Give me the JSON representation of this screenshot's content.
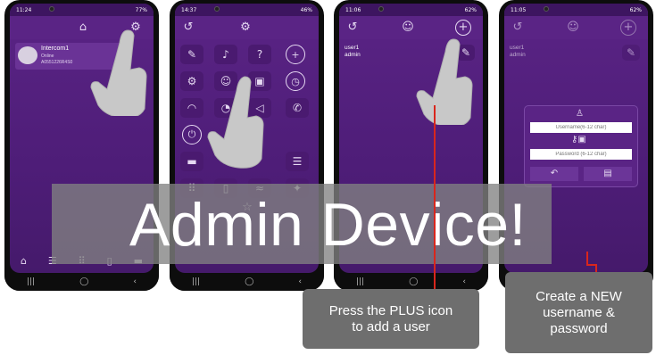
{
  "banner": {
    "title": "Admin Device!"
  },
  "callouts": {
    "plus_hint": "Press the PLUS icon to add a user",
    "create_hint": "Create a NEW username & password"
  },
  "colors": {
    "app_purple": "#5a2485",
    "overlay_gray": "#828282",
    "callout_gray": "#6e6e6e",
    "pointer_line": "#d9261c"
  },
  "phone1": {
    "status_time": "11:24",
    "status_right": "77%",
    "home_icon": "home-icon",
    "settings_icon": "gear-icon",
    "device": {
      "name": "Intercom1",
      "status": "Online",
      "id": "A0551226R4S0"
    },
    "bottom_icons": [
      "home-icon",
      "list-search-icon",
      "keypad-icon",
      "door-icon",
      "chat-icon"
    ]
  },
  "phone2": {
    "status_time": "14:37",
    "status_right": "46%",
    "icons": [
      "back-icon",
      "settings-icon",
      "edit-icon",
      "music-icon",
      "help-icon",
      "plus-icon",
      "settings-multi-icon",
      "users-icon",
      "lock-icon",
      "clock-icon",
      "wifi-icon",
      "bell-icon",
      "volume-icon",
      "phone-icon",
      "power-icon",
      "chat-icon",
      "list-search-icon",
      "keypad-icon",
      "door-open-icon",
      "pool-icon",
      "run-icon",
      "award-icon"
    ]
  },
  "phone3": {
    "status_time": "11:06",
    "status_right": "62%",
    "users": [
      "user1",
      "admin"
    ]
  },
  "phone4": {
    "status_time": "11:05",
    "status_right": "62%",
    "users": [
      "user1",
      "admin"
    ],
    "dialog": {
      "username_placeholder": "Username(6-12 char)",
      "password_placeholder": "Password (6-12 char)"
    }
  },
  "nav": {
    "recent": "|||",
    "home": "◯",
    "back": "‹"
  }
}
